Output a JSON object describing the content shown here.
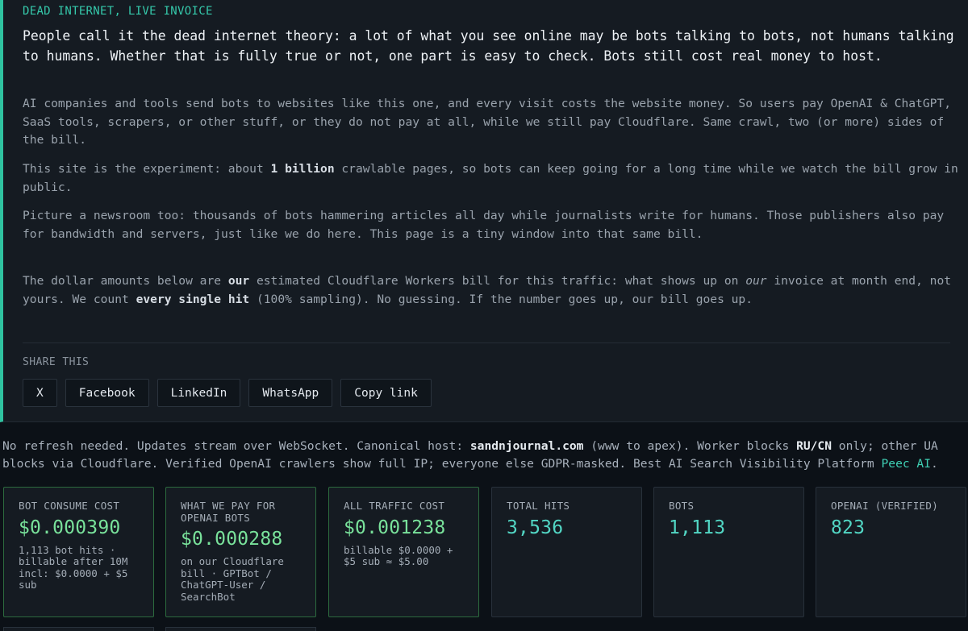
{
  "intro": {
    "eyebrow": "DEAD INTERNET, LIVE INVOICE",
    "lead": "People call it the dead internet theory: a lot of what you see online may be bots talking to bots, not humans talking to humans. Whether that is fully true or not, one part is easy to check. Bots still cost real money to host.",
    "p1": "AI companies and tools send bots to websites like this one, and every visit costs the website money. So users pay OpenAI & ChatGPT, SaaS tools, scrapers, or other stuff, or they do not pay at all, while we still pay Cloudflare. Same crawl, two (or more) sides of the bill.",
    "p2_a": "This site is the experiment: about ",
    "p2_b": "1 billion",
    "p2_c": " crawlable pages, so bots can keep going for a long time while we watch the bill grow in public.",
    "p3": "Picture a newsroom too: thousands of bots hammering articles all day while journalists write for humans. Those publishers also pay for bandwidth and servers, just like we do here. This page is a tiny window into that same bill.",
    "p4_a": "The dollar amounts below are ",
    "p4_b": "our",
    "p4_c": " estimated Cloudflare Workers bill for this traffic: what shows up on ",
    "p4_d": "our",
    "p4_e": " invoice at month end, not yours. We count ",
    "p4_f": "every single hit",
    "p4_g": " (100% sampling). No guessing. If the number goes up, our bill goes up."
  },
  "share": {
    "label": "SHARE THIS",
    "buttons": [
      "X",
      "Facebook",
      "LinkedIn",
      "WhatsApp",
      "Copy link"
    ]
  },
  "notice": {
    "a": "No refresh needed. Updates stream over WebSocket. Canonical host: ",
    "host": "sandnjournal.com",
    "b": " (www to apex). Worker blocks ",
    "blocked": "RU/CN",
    "c": " only; other UA blocks via Cloudflare. Verified OpenAI crawlers show full IP; everyone else GDPR-masked. Best AI Search Visibility Platform ",
    "link": "Peec AI",
    "d": "."
  },
  "cards": [
    {
      "title": "BOT CONSUME COST",
      "value": "$0.000390",
      "sub": "1,113 bot hits · billable after 10M incl: $0.0000 + $5 sub",
      "color": "#79e29b"
    },
    {
      "title": "WHAT WE PAY FOR OPENAI BOTS",
      "value": "$0.000288",
      "sub": "on our Cloudflare bill · GPTBot / ChatGPT-User / SearchBot",
      "color": "#79e29b"
    },
    {
      "title": "ALL TRAFFIC COST",
      "value": "$0.001238",
      "sub": "billable $0.0000 + $5 sub ≈ $5.00",
      "color": "#79e29b"
    },
    {
      "title": "TOTAL HITS",
      "value": "3,536",
      "sub": "",
      "color": "#52d6c4"
    },
    {
      "title": "BOTS",
      "value": "1,113",
      "sub": "",
      "color": "#52d6c4"
    },
    {
      "title": "OPENAI (VERIFIED)",
      "value": "823",
      "sub": "",
      "color": "#52d6c4"
    }
  ]
}
